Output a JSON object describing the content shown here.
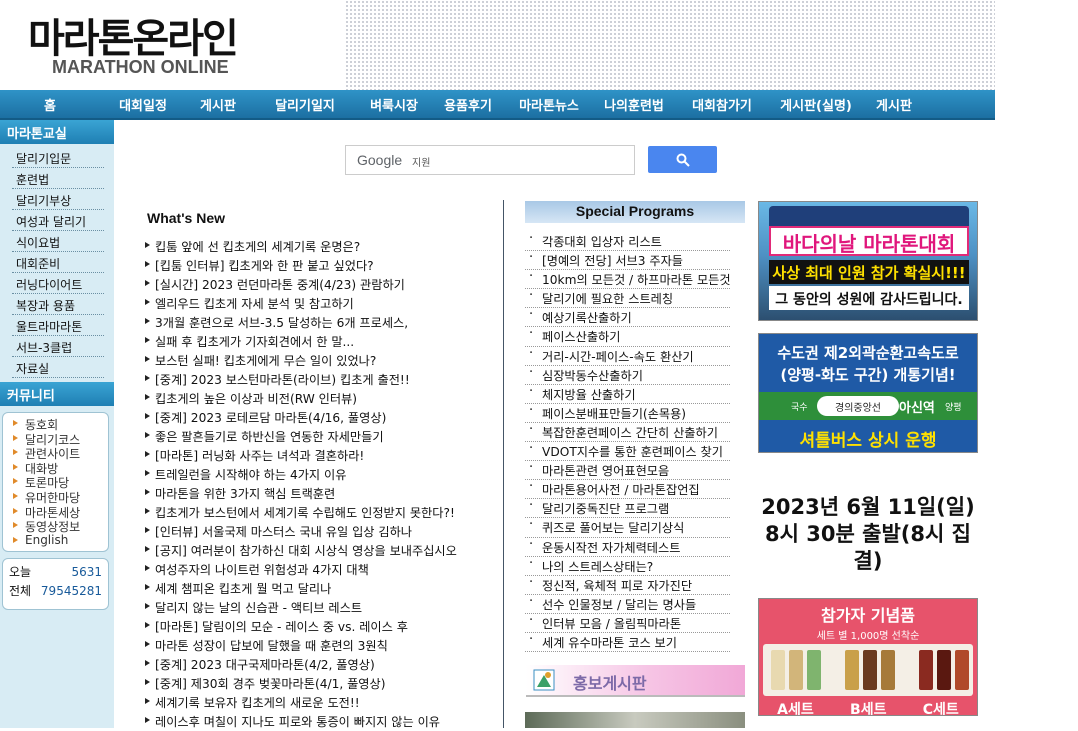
{
  "header": {
    "logo_ko": "마라톤온라인",
    "logo_en": "MARATHON ONLINE"
  },
  "nav": [
    "홈",
    "대회일정",
    "게시판",
    "달리기일지",
    "벼룩시장",
    "용품후기",
    "마라톤뉴스",
    "나의훈련법",
    "대회참가기",
    "게시판(실명)",
    "게시판"
  ],
  "sidebar": {
    "class_title": "마라톤교실",
    "class_items": [
      "달리기입문",
      "훈련법",
      "달리기부상",
      "여성과 달리기",
      "식이요법",
      "대회준비",
      "러닝다이어트",
      "복장과 용품",
      "울트라마라톤",
      "서브-3클럽",
      "자료실"
    ],
    "community_title": "커뮤니티",
    "community_items": [
      "동호회",
      "달리기코스",
      "관련사이트",
      "대화방",
      "토론마당",
      "유머한마당",
      "마라톤세상",
      "동영상정보",
      "English"
    ],
    "counter": {
      "today_label": "오늘",
      "today_value": "5631",
      "total_label": "전체",
      "total_value": "79545281"
    }
  },
  "search": {
    "brand": "Google",
    "sub": "지원"
  },
  "whats_new": {
    "title": "What's New",
    "items": [
      "킵툼 앞에 선 킵초게의 세계기록 운명은?",
      "[킵툼 인터뷰] 킵초게와 한 판 붙고 싶었다?",
      "[실시간] 2023 런던마라톤 중계(4/23) 관람하기",
      "엘리우드 킵초게 자세 분석 및 참고하기",
      "3개월 훈련으로 서브-3.5 달성하는 6개 프로세스,",
      "실패 후 킵초게가 기자회견에서 한 말...",
      "보스턴 실패! 킵초게에게 무슨 일이 있었나?",
      "[중계] 2023 보스턴마라톤(라이브) 킵초게 출전!!",
      "킵초게의 높은 이상과 비전(RW 인터뷰)",
      "[중계] 2023 로테르담 마라톤(4/16, 풀영상)",
      "좋은 팔흔들기로 하반신을 연동한 자세만들기",
      "[마라톤] 러닝화 사주는 녀석과 결혼하라!",
      "트레일런을 시작해야 하는 4가지 이유",
      "마라톤을 위한 3가지 핵심 트랙훈련",
      "킵초게가 보스턴에서 세계기록 수립해도 인정받지 못한다?!",
      "[인터뷰] 서울국제 마스터스 국내 유일 입상 김하나",
      "[공지] 여러분이 참가하신 대회 시상식 영상을 보내주십시오",
      "여성주자의 나이트런 위험성과 4가지 대책",
      "세계 챔피온 킵초게 뭘 먹고 달리나",
      "달리지 않는 날의 신습관 - 액티브 레스트",
      "[마라톤] 달림이의 모순 - 레이스 중 vs. 레이스 후",
      "마라톤 성장이 답보에 달했을 때 훈련의 3원칙",
      "[중계] 2023 대구국제마라톤(4/2, 풀영상)",
      "[중계] 제30회 경주 벚꽃마라톤(4/1, 풀영상)",
      "세계기록 보유자 킵초게의 새로운 도전!!",
      "레이스후 며칠이 지나도 피로와 통증이 빠지지 않는 이유"
    ]
  },
  "special": {
    "title": "Special Programs",
    "items": [
      "각종대회 입상자 리스트",
      "[명예의 전당] 서브3 주자들",
      "10km의 모든것 / 하프마라톤 모든것",
      "달리기에 필요한 스트레칭",
      "예상기록산출하기",
      "페이스산출하기",
      "거리-시간-페이스-속도 환산기",
      "심장박동수산출하기",
      "체지방율 산출하기",
      "페이스분배표만들기(손목용)",
      "복잡한훈련페이스 간단히 산출하기",
      "VDOT지수를 통한 훈련페이스 찾기",
      "마라톤관련 영어표현모음",
      "마라톤용어사전 / 마라톤잡언집",
      "달리기중독진단 프로그램",
      "퀴즈로 풀어보는 달리기상식",
      "운동시작전 자가체력테스트",
      "나의 스트레스상태는?",
      "정신적, 육체적 피로 자가진단",
      "선수 인물정보 / 달리는 명사들",
      "인터뷰 모음 / 올림픽마라톤",
      "세계 유수마라톤 코스 보기"
    ],
    "promo": "홍보게시판"
  },
  "ads": {
    "ad1": {
      "line1": "바다의날 마라톤대회",
      "line2": "사상 최대 인원 참가 확실시!!!",
      "line3": "그 동안의 성원에 감사드립니다."
    },
    "ad2": {
      "line1": "수도권 제2외곽순환고속도로",
      "line2": "(양평-화도 구간) 개통기념!",
      "band_left": "국수",
      "band_mid": "경의중앙선",
      "band_name": "아신역",
      "band_right": "양평",
      "line3": "셔틀버스 상시 운행"
    },
    "date": {
      "line1": "2023년 6월 11일(일)",
      "line2": "8시 30분 출발(8시 집결)"
    },
    "ad3": {
      "title": "참가자 기념품",
      "sub": "세트 별 1,000명 선착순",
      "sets": [
        "A세트",
        "B세트",
        "C세트"
      ]
    }
  }
}
